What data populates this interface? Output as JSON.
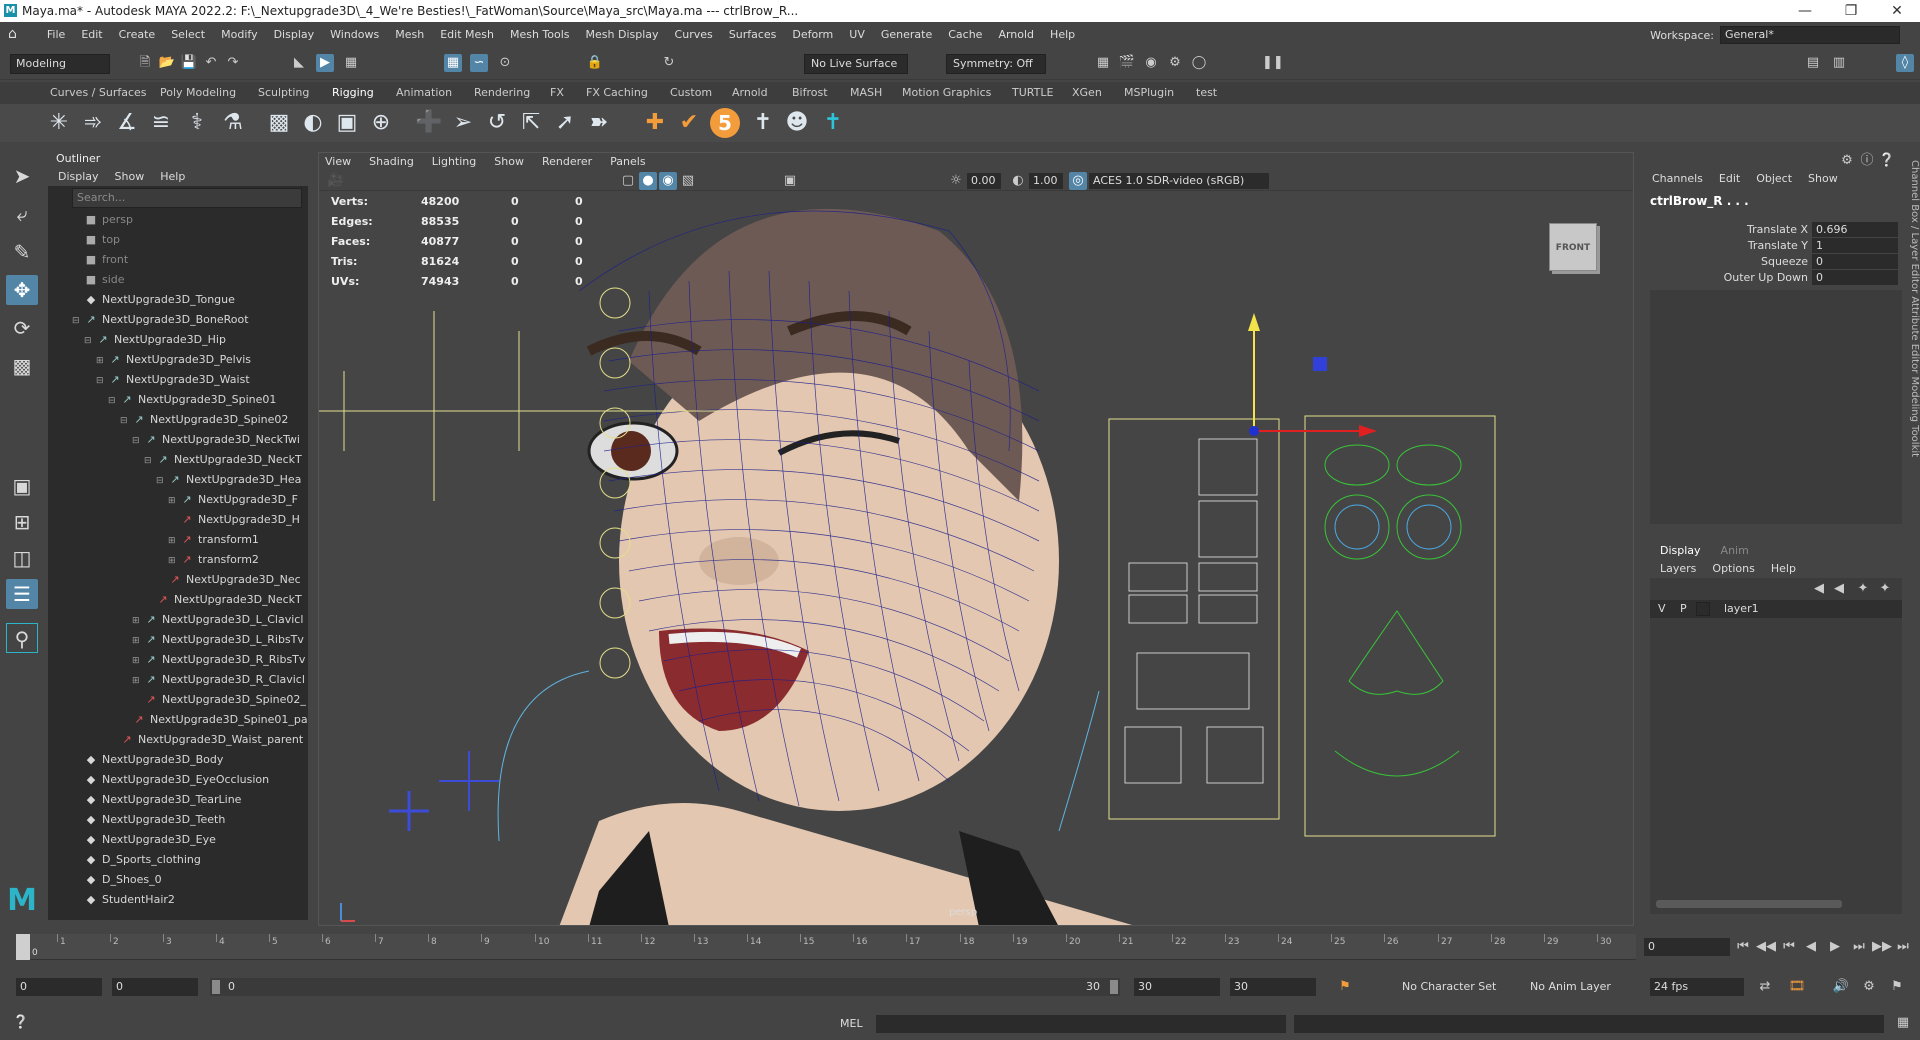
{
  "window": {
    "title": "Maya.ma* - Autodesk MAYA 2022.2: F:\\_Nextupgrade3D\\_4_We're Besties!\\_FatWoman\\Source\\Maya_src\\Maya.ma   ---   ctrlBrow_R..."
  },
  "menu": [
    "File",
    "Edit",
    "Create",
    "Select",
    "Modify",
    "Display",
    "Windows",
    "Mesh",
    "Edit Mesh",
    "Mesh Tools",
    "Mesh Display",
    "Curves",
    "Surfaces",
    "Deform",
    "UV",
    "Generate",
    "Cache",
    "Arnold",
    "Help"
  ],
  "workspace": {
    "label": "Workspace:",
    "value": "General*"
  },
  "status": {
    "mode": "Modeling",
    "live_surface": "No Live Surface",
    "symmetry": "Symmetry: Off"
  },
  "shelf_tabs": [
    "Curves / Surfaces",
    "Poly Modeling",
    "Sculpting",
    "Rigging",
    "Animation",
    "Rendering",
    "FX",
    "FX Caching",
    "Custom",
    "Arnold",
    "Bifrost",
    "MASH",
    "Motion Graphics",
    "TURTLE",
    "XGen",
    "MSPlugin",
    "test"
  ],
  "active_shelf": "Rigging",
  "outliner": {
    "title": "Outliner",
    "menu": [
      "Display",
      "Show",
      "Help"
    ],
    "search_placeholder": "Search...",
    "items": [
      {
        "label": "persp",
        "depth": 0,
        "icon": "camera",
        "dim": true
      },
      {
        "label": "top",
        "depth": 0,
        "icon": "camera",
        "dim": true
      },
      {
        "label": "front",
        "depth": 0,
        "icon": "camera",
        "dim": true
      },
      {
        "label": "side",
        "depth": 0,
        "icon": "camera",
        "dim": true
      },
      {
        "label": "NextUpgrade3D_Tongue",
        "depth": 0,
        "icon": "mesh"
      },
      {
        "label": "NextUpgrade3D_BoneRoot",
        "depth": 0,
        "icon": "joint",
        "exp": "-"
      },
      {
        "label": "NextUpgrade3D_Hip",
        "depth": 1,
        "icon": "joint",
        "exp": "-"
      },
      {
        "label": "NextUpgrade3D_Pelvis",
        "depth": 2,
        "icon": "joint",
        "exp": "+"
      },
      {
        "label": "NextUpgrade3D_Waist",
        "depth": 2,
        "icon": "joint",
        "exp": "-"
      },
      {
        "label": "NextUpgrade3D_Spine01",
        "depth": 3,
        "icon": "joint",
        "exp": "-"
      },
      {
        "label": "NextUpgrade3D_Spine02",
        "depth": 4,
        "icon": "joint",
        "exp": "-"
      },
      {
        "label": "NextUpgrade3D_NeckTwi",
        "depth": 5,
        "icon": "joint",
        "exp": "-"
      },
      {
        "label": "NextUpgrade3D_NeckT",
        "depth": 6,
        "icon": "joint",
        "exp": "-"
      },
      {
        "label": "NextUpgrade3D_Hea",
        "depth": 7,
        "icon": "joint",
        "exp": "-"
      },
      {
        "label": "NextUpgrade3D_F",
        "depth": 8,
        "icon": "joint",
        "exp": "+"
      },
      {
        "label": "NextUpgrade3D_H",
        "depth": 8,
        "icon": "constraint"
      },
      {
        "label": "transform1",
        "depth": 8,
        "icon": "constraint",
        "exp": "+"
      },
      {
        "label": "transform2",
        "depth": 8,
        "icon": "constraint",
        "exp": "+"
      },
      {
        "label": "NextUpgrade3D_Nec",
        "depth": 7,
        "icon": "constraint"
      },
      {
        "label": "NextUpgrade3D_NeckT",
        "depth": 6,
        "icon": "constraint"
      },
      {
        "label": "NextUpgrade3D_L_Clavicl",
        "depth": 5,
        "icon": "joint",
        "exp": "+"
      },
      {
        "label": "NextUpgrade3D_L_RibsTv",
        "depth": 5,
        "icon": "joint",
        "exp": "+"
      },
      {
        "label": "NextUpgrade3D_R_RibsTv",
        "depth": 5,
        "icon": "joint",
        "exp": "+"
      },
      {
        "label": "NextUpgrade3D_R_Clavicl",
        "depth": 5,
        "icon": "joint",
        "exp": "+"
      },
      {
        "label": "NextUpgrade3D_Spine02_",
        "depth": 5,
        "icon": "constraint"
      },
      {
        "label": "NextUpgrade3D_Spine01_pa",
        "depth": 4,
        "icon": "constraint"
      },
      {
        "label": "NextUpgrade3D_Waist_parent",
        "depth": 3,
        "icon": "constraint"
      },
      {
        "label": "NextUpgrade3D_Body",
        "depth": 0,
        "icon": "mesh"
      },
      {
        "label": "NextUpgrade3D_EyeOcclusion",
        "depth": 0,
        "icon": "mesh"
      },
      {
        "label": "NextUpgrade3D_TearLine",
        "depth": 0,
        "icon": "mesh"
      },
      {
        "label": "NextUpgrade3D_Teeth",
        "depth": 0,
        "icon": "mesh"
      },
      {
        "label": "NextUpgrade3D_Eye",
        "depth": 0,
        "icon": "mesh"
      },
      {
        "label": "D_Sports_clothing",
        "depth": 0,
        "icon": "mesh"
      },
      {
        "label": "D_Shoes_0",
        "depth": 0,
        "icon": "mesh"
      },
      {
        "label": "StudentHair2",
        "depth": 0,
        "icon": "mesh"
      }
    ]
  },
  "viewport": {
    "menu": [
      "View",
      "Shading",
      "Lighting",
      "Show",
      "Renderer",
      "Panels"
    ],
    "exposure": "0.00",
    "gamma": "1.00",
    "colorspace": "ACES 1.0 SDR-video (sRGB)",
    "hud": [
      {
        "k": "Verts:",
        "v": "48200",
        "a": "0",
        "b": "0"
      },
      {
        "k": "Edges:",
        "v": "88535",
        "a": "0",
        "b": "0"
      },
      {
        "k": "Faces:",
        "v": "40877",
        "a": "0",
        "b": "0"
      },
      {
        "k": "Tris:",
        "v": "81624",
        "a": "0",
        "b": "0"
      },
      {
        "k": "UVs:",
        "v": "74943",
        "a": "0",
        "b": "0"
      }
    ],
    "viewcube": "FRONT",
    "camera": "persp"
  },
  "channelbox": {
    "menu": [
      "Channels",
      "Edit",
      "Object",
      "Show"
    ],
    "node": "ctrlBrow_R . . .",
    "attrs": [
      {
        "name": "Translate X",
        "value": "0.696"
      },
      {
        "name": "Translate Y",
        "value": "1"
      },
      {
        "name": "Squeeze",
        "value": "0"
      },
      {
        "name": "Outer Up Down",
        "value": "0"
      }
    ]
  },
  "layers": {
    "tabs": [
      "Display",
      "Anim"
    ],
    "menu": [
      "Layers",
      "Options",
      "Help"
    ],
    "row": {
      "v": "V",
      "p": "P",
      "name": "layer1"
    }
  },
  "sidetabs": "Channel Box / Layer Editor    Attribute Editor    Modeling Toolkit",
  "timeline": {
    "ticks": [
      1,
      2,
      3,
      4,
      5,
      6,
      7,
      8,
      9,
      10,
      11,
      12,
      13,
      14,
      15,
      16,
      17,
      18,
      19,
      20,
      21,
      22,
      23,
      24,
      25,
      26,
      27,
      28,
      29,
      30
    ],
    "current": "0",
    "current_field": "0"
  },
  "range": {
    "start": "0",
    "start2": "0",
    "slider_left": "0",
    "slider_right": "30",
    "end": "30",
    "end2": "30",
    "character": "No Character Set",
    "anim_layer": "No Anim Layer",
    "fps": "24 fps"
  },
  "cmd": {
    "label": "MEL"
  }
}
